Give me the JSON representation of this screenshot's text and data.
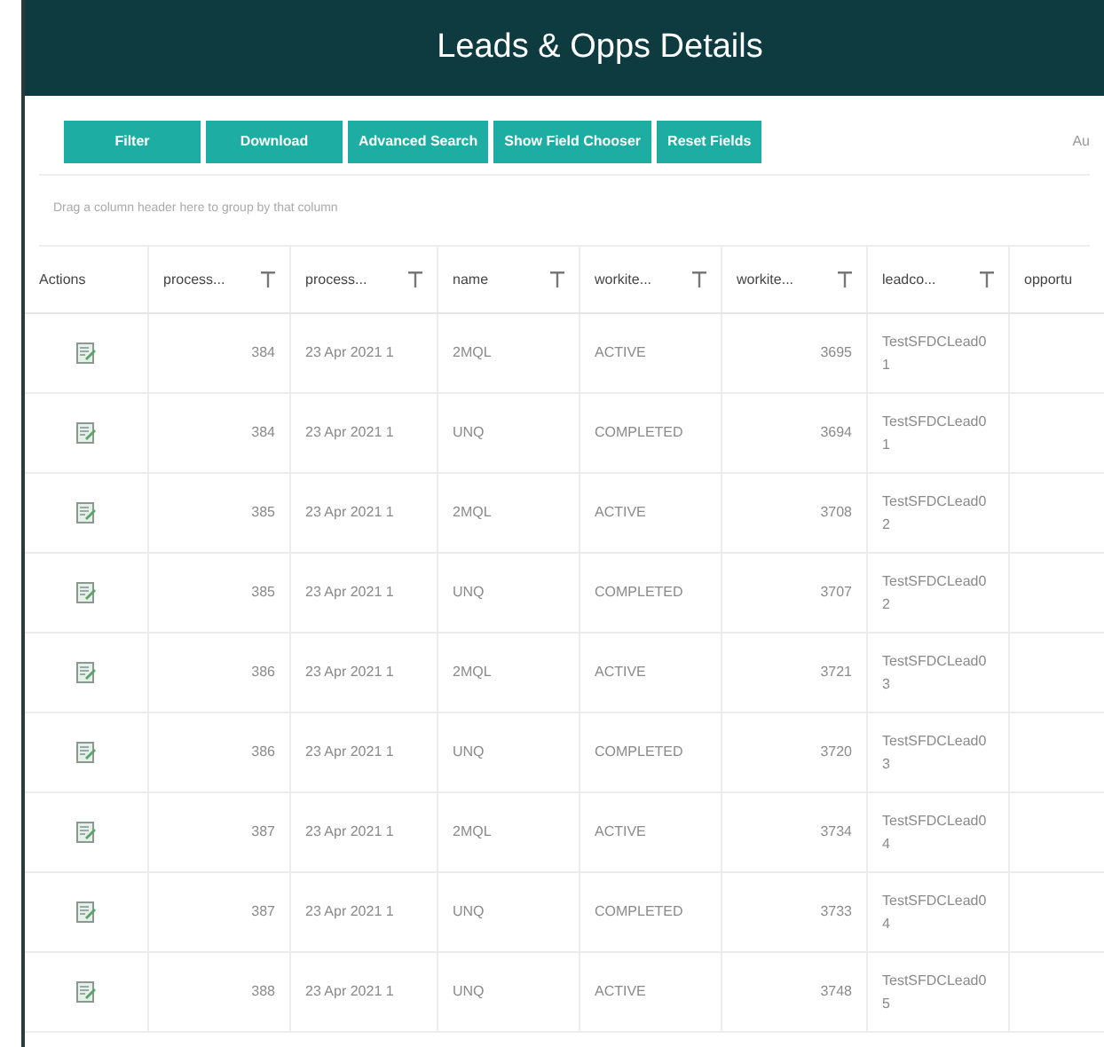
{
  "header": {
    "title": "Leads & Opps Details"
  },
  "toolbar": {
    "buttons": [
      "Filter",
      "Download",
      "Advanced Search",
      "Show Field Chooser",
      "Reset Fields"
    ],
    "right_text": "Au"
  },
  "group_hint": "Drag a column header here to group by that column",
  "table": {
    "columns": [
      {
        "label": "Actions",
        "filter": false
      },
      {
        "label": "process...",
        "filter": true
      },
      {
        "label": "process...",
        "filter": true
      },
      {
        "label": "name",
        "filter": true
      },
      {
        "label": "workite...",
        "filter": true
      },
      {
        "label": "workite...",
        "filter": true
      },
      {
        "label": "leadco...",
        "filter": true
      },
      {
        "label": "opportu",
        "filter": false
      }
    ],
    "rows": [
      {
        "process_id": "384",
        "process_date": "23 Apr 2021 1",
        "name": "2MQL",
        "status": "ACTIVE",
        "workitem_id": "3695",
        "lead": "TestSFDCLead01"
      },
      {
        "process_id": "384",
        "process_date": "23 Apr 2021 1",
        "name": "UNQ",
        "status": "COMPLETED",
        "workitem_id": "3694",
        "lead": "TestSFDCLead01"
      },
      {
        "process_id": "385",
        "process_date": "23 Apr 2021 1",
        "name": "2MQL",
        "status": "ACTIVE",
        "workitem_id": "3708",
        "lead": "TestSFDCLead02"
      },
      {
        "process_id": "385",
        "process_date": "23 Apr 2021 1",
        "name": "UNQ",
        "status": "COMPLETED",
        "workitem_id": "3707",
        "lead": "TestSFDCLead02"
      },
      {
        "process_id": "386",
        "process_date": "23 Apr 2021 1",
        "name": "2MQL",
        "status": "ACTIVE",
        "workitem_id": "3721",
        "lead": "TestSFDCLead03"
      },
      {
        "process_id": "386",
        "process_date": "23 Apr 2021 1",
        "name": "UNQ",
        "status": "COMPLETED",
        "workitem_id": "3720",
        "lead": "TestSFDCLead03"
      },
      {
        "process_id": "387",
        "process_date": "23 Apr 2021 1",
        "name": "2MQL",
        "status": "ACTIVE",
        "workitem_id": "3734",
        "lead": "TestSFDCLead04"
      },
      {
        "process_id": "387",
        "process_date": "23 Apr 2021 1",
        "name": "UNQ",
        "status": "COMPLETED",
        "workitem_id": "3733",
        "lead": "TestSFDCLead04"
      },
      {
        "process_id": "388",
        "process_date": "23 Apr 2021 1",
        "name": "UNQ",
        "status": "ACTIVE",
        "workitem_id": "3748",
        "lead": "TestSFDCLead05"
      }
    ]
  }
}
